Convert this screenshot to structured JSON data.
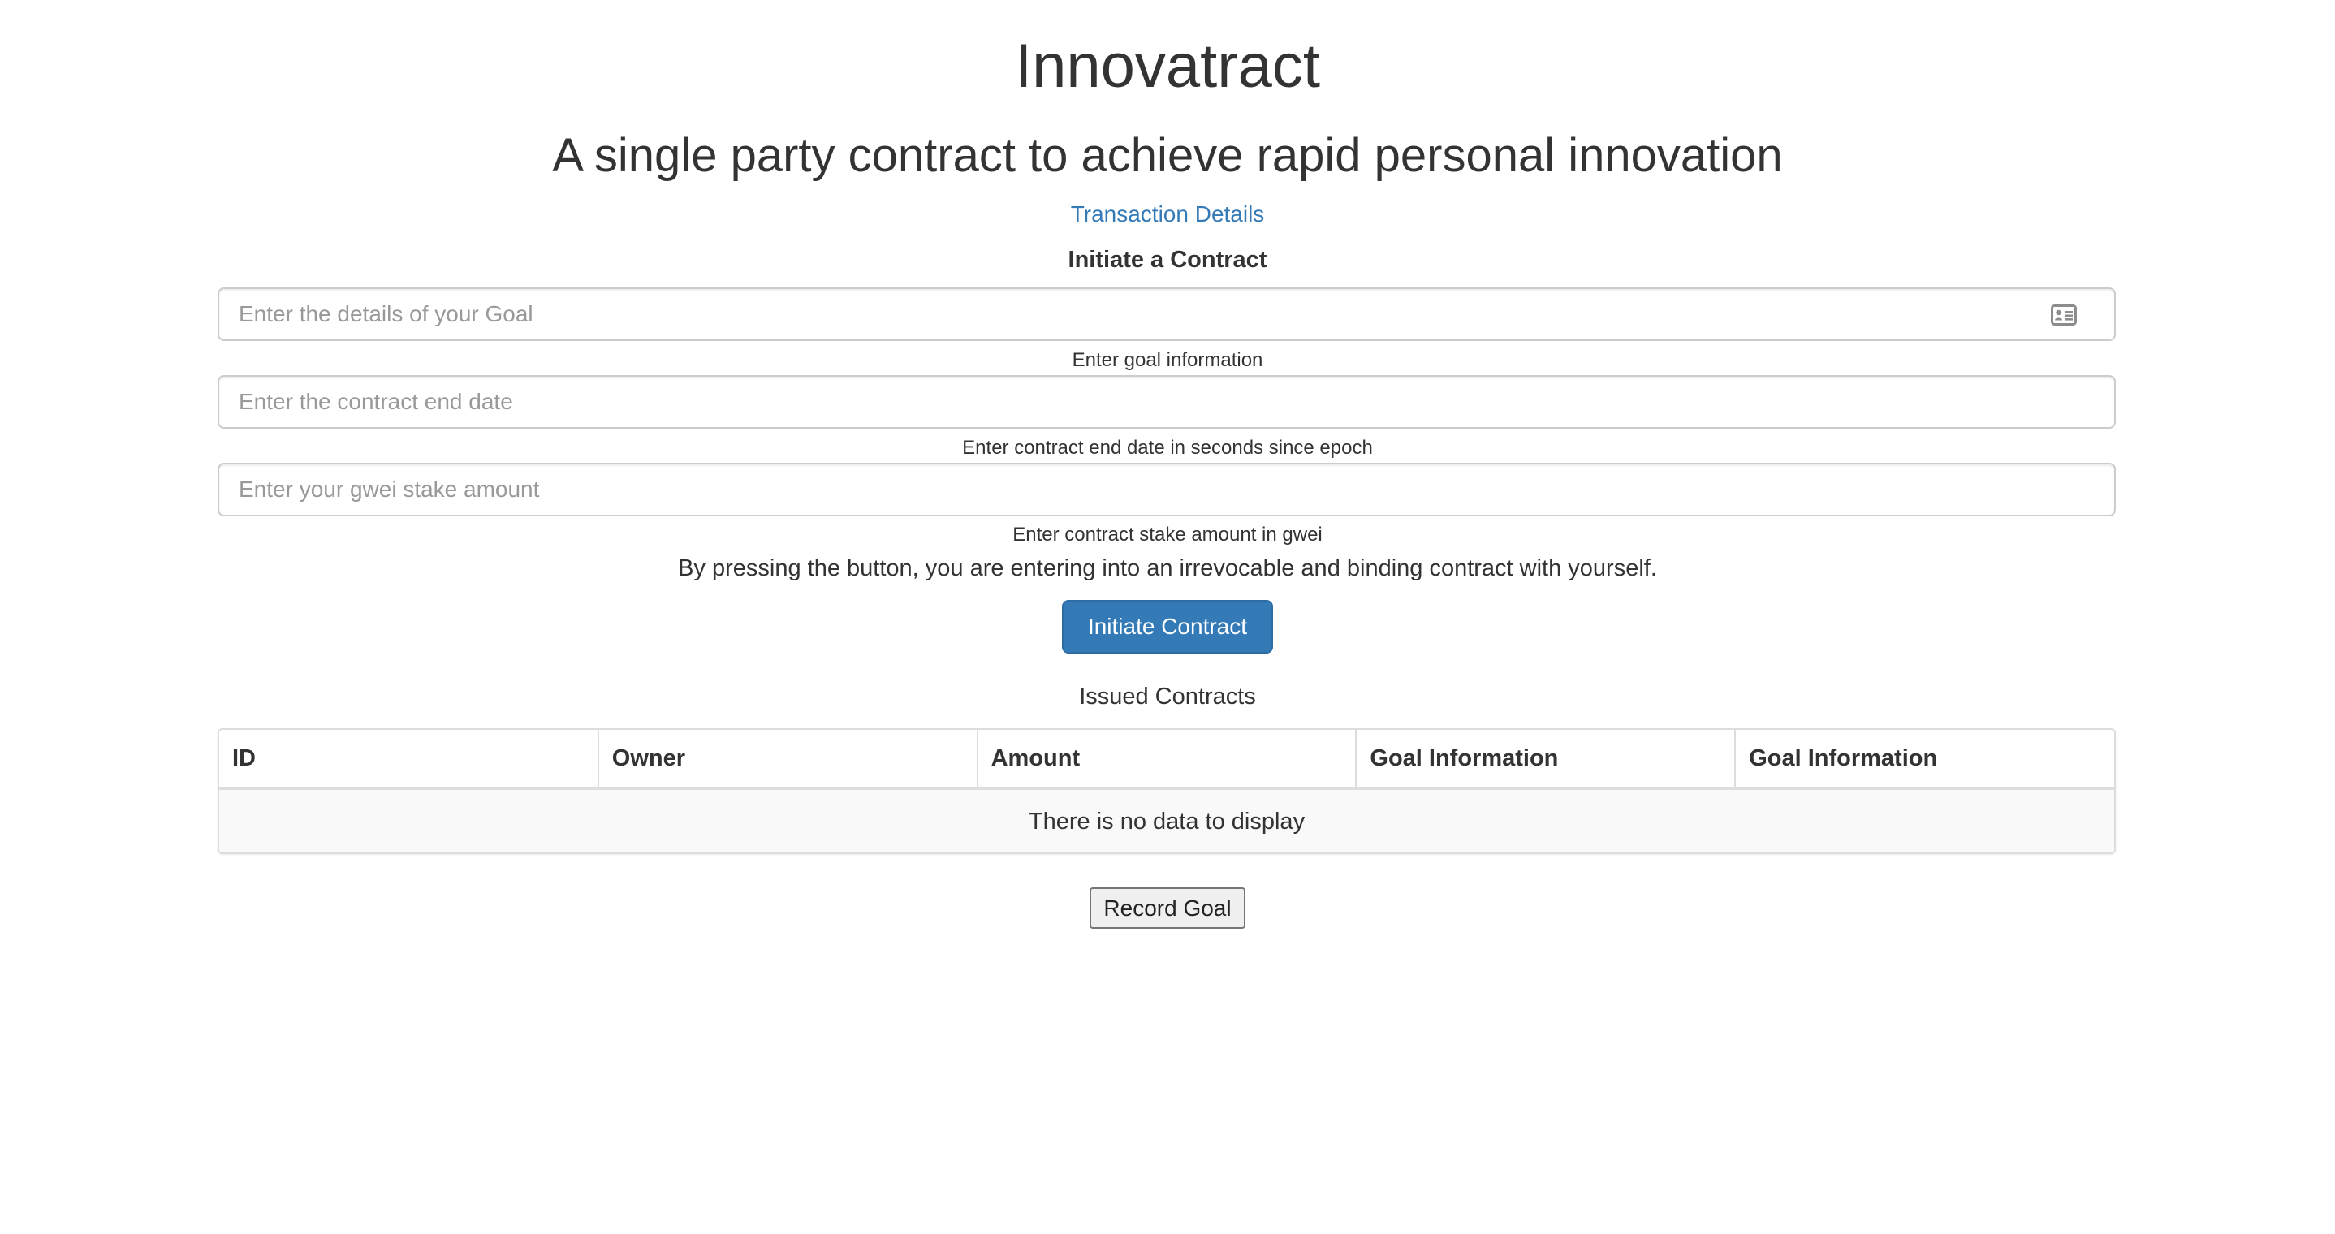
{
  "header": {
    "title": "Innovatract",
    "subtitle": "A single party contract to achieve rapid personal innovation",
    "transaction_link": "Transaction Details"
  },
  "form": {
    "heading": "Initiate a Contract",
    "goal": {
      "placeholder": "Enter the details of your Goal",
      "value": "",
      "help": "Enter goal information",
      "icon": "contact-card-icon"
    },
    "end_date": {
      "placeholder": "Enter the contract end date",
      "value": "",
      "help": "Enter contract end date in seconds since epoch"
    },
    "stake": {
      "placeholder": "Enter your gwei stake amount",
      "value": "",
      "help": "Enter contract stake amount in gwei"
    },
    "notice": "By pressing the button, you are entering into an irrevocable and binding contract with yourself.",
    "submit_label": "Initiate Contract"
  },
  "contracts": {
    "caption": "Issued Contracts",
    "columns": [
      "ID",
      "Owner",
      "Amount",
      "Goal Information",
      "Goal Information"
    ],
    "rows": [],
    "empty_text": "There is no data to display"
  },
  "footer": {
    "record_label": "Record Goal"
  },
  "colors": {
    "primary": "#337ab7",
    "link": "#337ab7",
    "text": "#333333",
    "border": "#cccccc"
  }
}
